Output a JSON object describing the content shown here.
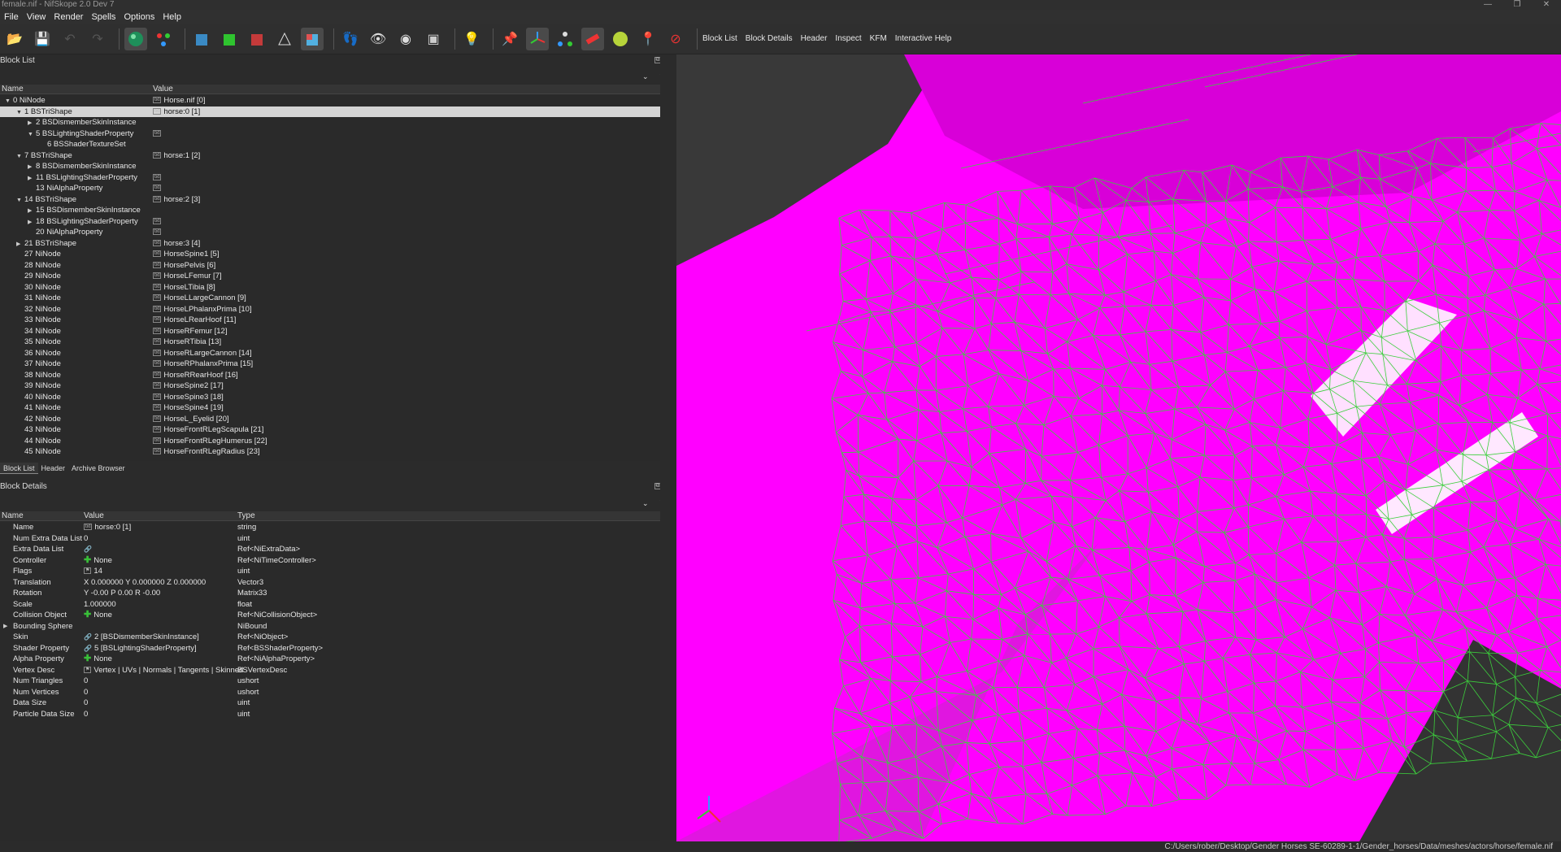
{
  "window": {
    "title": "female.nif - NifSkope 2.0 Dev 7",
    "controls": [
      "—",
      "❐",
      "✕"
    ]
  },
  "menu": [
    "File",
    "View",
    "Render",
    "Spells",
    "Options",
    "Help"
  ],
  "toolbar_text": [
    "Block List",
    "Block Details",
    "Header",
    "Inspect",
    "KFM",
    "Interactive Help"
  ],
  "block_list": {
    "title": "Block List",
    "col_name": "Name",
    "col_value": "Value",
    "rows": [
      {
        "name": "0 NiNode",
        "value": "Horse.nif [0]",
        "indent": 0,
        "arrow": "▼",
        "icon": true
      },
      {
        "name": "1 BSTriShape",
        "value": "horse:0 [1]",
        "indent": 1,
        "arrow": "▼",
        "icon": true,
        "selected": true
      },
      {
        "name": "2 BSDismemberSkinInstance",
        "value": "",
        "indent": 2,
        "arrow": "▶",
        "icon": false
      },
      {
        "name": "5 BSLightingShaderProperty",
        "value": "",
        "indent": 2,
        "arrow": "▼",
        "icon": true
      },
      {
        "name": "6 BSShaderTextureSet",
        "value": "",
        "indent": 3,
        "arrow": "",
        "icon": false
      },
      {
        "name": "7 BSTriShape",
        "value": "horse:1 [2]",
        "indent": 1,
        "arrow": "▼",
        "icon": true
      },
      {
        "name": "8 BSDismemberSkinInstance",
        "value": "",
        "indent": 2,
        "arrow": "▶",
        "icon": false
      },
      {
        "name": "11 BSLightingShaderProperty",
        "value": "",
        "indent": 2,
        "arrow": "▶",
        "icon": true
      },
      {
        "name": "13 NiAlphaProperty",
        "value": "",
        "indent": 2,
        "arrow": "",
        "icon": true
      },
      {
        "name": "14 BSTriShape",
        "value": "horse:2 [3]",
        "indent": 1,
        "arrow": "▼",
        "icon": true
      },
      {
        "name": "15 BSDismemberSkinInstance",
        "value": "",
        "indent": 2,
        "arrow": "▶",
        "icon": false
      },
      {
        "name": "18 BSLightingShaderProperty",
        "value": "",
        "indent": 2,
        "arrow": "▶",
        "icon": true
      },
      {
        "name": "20 NiAlphaProperty",
        "value": "",
        "indent": 2,
        "arrow": "",
        "icon": true
      },
      {
        "name": "21 BSTriShape",
        "value": "horse:3 [4]",
        "indent": 1,
        "arrow": "▶",
        "icon": true
      },
      {
        "name": "27 NiNode",
        "value": "HorseSpine1 [5]",
        "indent": 1,
        "arrow": "",
        "icon": true
      },
      {
        "name": "28 NiNode",
        "value": "HorsePelvis [6]",
        "indent": 1,
        "arrow": "",
        "icon": true
      },
      {
        "name": "29 NiNode",
        "value": "HorseLFemur [7]",
        "indent": 1,
        "arrow": "",
        "icon": true
      },
      {
        "name": "30 NiNode",
        "value": "HorseLTibia [8]",
        "indent": 1,
        "arrow": "",
        "icon": true
      },
      {
        "name": "31 NiNode",
        "value": "HorseLLargeCannon [9]",
        "indent": 1,
        "arrow": "",
        "icon": true
      },
      {
        "name": "32 NiNode",
        "value": "HorseLPhalanxPrima [10]",
        "indent": 1,
        "arrow": "",
        "icon": true
      },
      {
        "name": "33 NiNode",
        "value": "HorseLRearHoof [11]",
        "indent": 1,
        "arrow": "",
        "icon": true
      },
      {
        "name": "34 NiNode",
        "value": "HorseRFemur [12]",
        "indent": 1,
        "arrow": "",
        "icon": true
      },
      {
        "name": "35 NiNode",
        "value": "HorseRTibia [13]",
        "indent": 1,
        "arrow": "",
        "icon": true
      },
      {
        "name": "36 NiNode",
        "value": "HorseRLargeCannon [14]",
        "indent": 1,
        "arrow": "",
        "icon": true
      },
      {
        "name": "37 NiNode",
        "value": "HorseRPhalanxPrima [15]",
        "indent": 1,
        "arrow": "",
        "icon": true
      },
      {
        "name": "38 NiNode",
        "value": "HorseRRearHoof [16]",
        "indent": 1,
        "arrow": "",
        "icon": true
      },
      {
        "name": "39 NiNode",
        "value": "HorseSpine2 [17]",
        "indent": 1,
        "arrow": "",
        "icon": true
      },
      {
        "name": "40 NiNode",
        "value": "HorseSpine3 [18]",
        "indent": 1,
        "arrow": "",
        "icon": true
      },
      {
        "name": "41 NiNode",
        "value": "HorseSpine4 [19]",
        "indent": 1,
        "arrow": "",
        "icon": true
      },
      {
        "name": "42 NiNode",
        "value": "HorseL_Eyelid [20]",
        "indent": 1,
        "arrow": "",
        "icon": true
      },
      {
        "name": "43 NiNode",
        "value": "HorseFrontRLegScapula [21]",
        "indent": 1,
        "arrow": "",
        "icon": true
      },
      {
        "name": "44 NiNode",
        "value": "HorseFrontRLegHumerus [22]",
        "indent": 1,
        "arrow": "",
        "icon": true
      },
      {
        "name": "45 NiNode",
        "value": "HorseFrontRLegRadius [23]",
        "indent": 1,
        "arrow": "",
        "icon": true
      }
    ]
  },
  "tabs": [
    "Block List",
    "Header",
    "Archive Browser"
  ],
  "block_details": {
    "title": "Block Details",
    "col_name": "Name",
    "col_value": "Value",
    "col_type": "Type",
    "rows": [
      {
        "name": "Name",
        "value": "horse:0 [1]",
        "type": "string",
        "marker": "txt"
      },
      {
        "name": "Num Extra Data List",
        "value": "0",
        "type": "uint",
        "marker": ""
      },
      {
        "name": "Extra Data List",
        "value": "",
        "type": "Ref<NiExtraData>",
        "marker": "link"
      },
      {
        "name": "Controller",
        "value": "None",
        "type": "Ref<NiTimeController>",
        "marker": "plus"
      },
      {
        "name": "Flags",
        "value": "14",
        "type": "uint",
        "marker": "flag"
      },
      {
        "name": "Translation",
        "value": "X 0.000000 Y 0.000000 Z 0.000000",
        "type": "Vector3",
        "marker": ""
      },
      {
        "name": "Rotation",
        "value": "Y -0.00 P 0.00 R -0.00",
        "type": "Matrix33",
        "marker": ""
      },
      {
        "name": "Scale",
        "value": "1.000000",
        "type": "float",
        "marker": ""
      },
      {
        "name": "Collision Object",
        "value": "None",
        "type": "Ref<NiCollisionObject>",
        "marker": "plus"
      },
      {
        "name": "Bounding Sphere",
        "value": "",
        "type": "NiBound",
        "marker": "",
        "expand": true
      },
      {
        "name": "Skin",
        "value": "2 [BSDismemberSkinInstance]",
        "type": "Ref<NiObject>",
        "marker": "link"
      },
      {
        "name": "Shader Property",
        "value": "5 [BSLightingShaderProperty]",
        "type": "Ref<BSShaderProperty>",
        "marker": "link"
      },
      {
        "name": "Alpha Property",
        "value": "None",
        "type": "Ref<NiAlphaProperty>",
        "marker": "plus"
      },
      {
        "name": "Vertex Desc",
        "value": "Vertex | UVs | Normals | Tangents | Skinned",
        "type": "BSVertexDesc",
        "marker": "flag"
      },
      {
        "name": "Num Triangles",
        "value": "0",
        "type": "ushort",
        "marker": ""
      },
      {
        "name": "Num Vertices",
        "value": "0",
        "type": "ushort",
        "marker": ""
      },
      {
        "name": "Data Size",
        "value": "0",
        "type": "uint",
        "marker": ""
      },
      {
        "name": "Particle Data Size",
        "value": "0",
        "type": "uint",
        "marker": ""
      }
    ]
  },
  "status": {
    "path": "C:/Users/rober/Desktop/Gender Horses SE-60289-1-1/Gender_horses/Data/meshes/actors/horse/female.nif"
  },
  "colors": {
    "mesh": "#ff00ff",
    "wire": "#3ccf3c",
    "background": "#393939",
    "selection": "#d4d4d4"
  }
}
